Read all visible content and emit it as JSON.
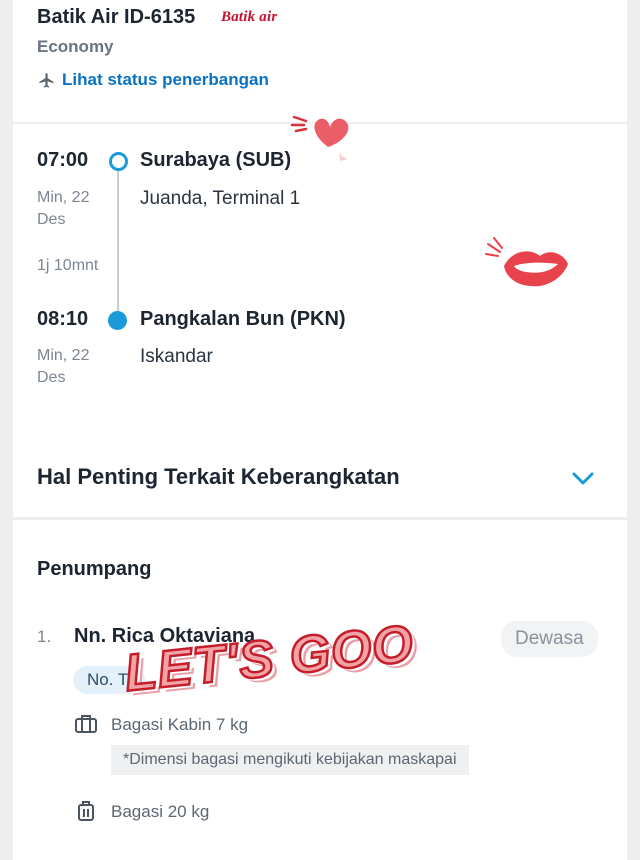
{
  "flight": {
    "airline_title": "Batik Air ID-6135",
    "airline_logo_text": "Batik air",
    "cabin_class": "Economy",
    "status_link": "Lihat status penerbangan"
  },
  "route": {
    "departure": {
      "time": "07:00",
      "date": "Min, 22 Des",
      "city": "Surabaya (SUB)",
      "airport": "Juanda, Terminal 1"
    },
    "duration": "1j 10mnt",
    "arrival": {
      "time": "08:10",
      "date": "Min, 22 Des",
      "city": "Pangkalan Bun (PKN)",
      "airport": "Iskandar"
    },
    "important_info_title": "Hal Penting Terkait Keberangkatan"
  },
  "passengers": {
    "section_title": "Penumpang",
    "items": [
      {
        "number": "1.",
        "name": "Nn. Rica Oktaviana",
        "type": "Dewasa",
        "ticket_label": "No. Ti",
        "cabin_baggage": "Bagasi Kabin 7 kg",
        "baggage_note": "*Dimensi bagasi mengikuti kebijakan maskapai",
        "checked_baggage": "Bagasi 20 kg"
      }
    ]
  },
  "sticker": {
    "text": "LET'S GOO"
  },
  "colors": {
    "accent": "#1a9ad8",
    "link": "#0a72c2",
    "sticker_red": "#c51d2a"
  },
  "icons": [
    "plane-status-icon",
    "chevron-down-icon",
    "cabin-bag-icon",
    "luggage-icon",
    "heart-sticker",
    "lips-sticker"
  ]
}
